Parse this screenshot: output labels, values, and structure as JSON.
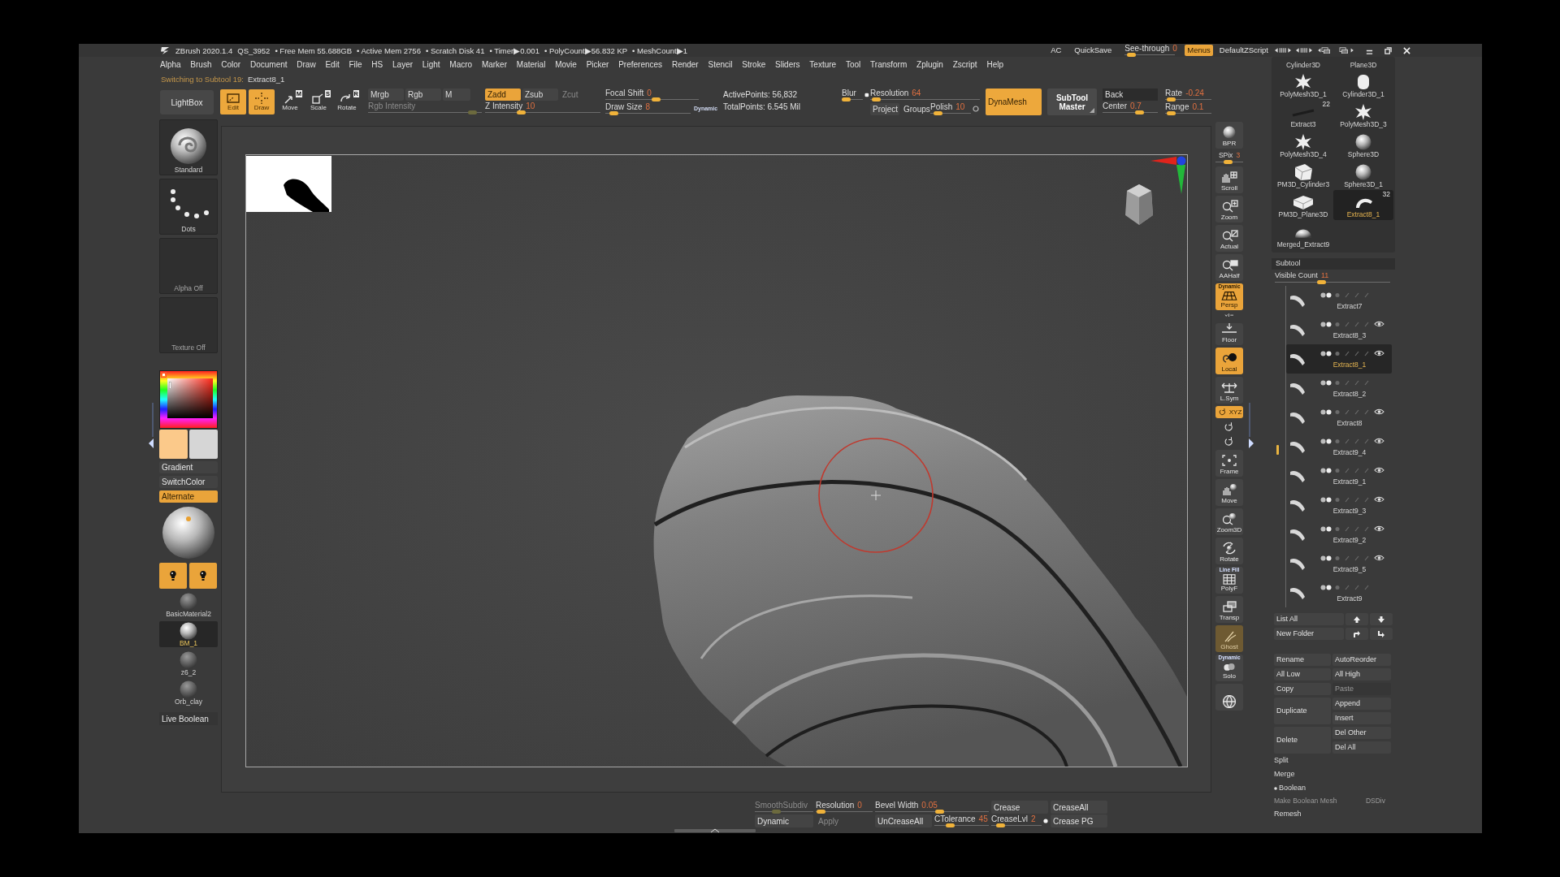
{
  "title_bar": {
    "app": "ZBrush 2020.1.4",
    "project": "QS_3952",
    "stats": [
      "• Free Mem 55.688GB",
      "• Active Mem 2756",
      "• Scratch Disk 41",
      "• Timer▶0.001",
      "• PolyCount▶56.832 KP",
      "• MeshCount▶1"
    ],
    "ac": "AC",
    "quicksave": "QuickSave",
    "see_through": {
      "label": "See-through",
      "value": "0",
      "level": 0.05
    },
    "menus": {
      "label": "Menus",
      "on": true
    },
    "script": "DefaultZScript"
  },
  "menu": [
    "Alpha",
    "Brush",
    "Color",
    "Document",
    "Draw",
    "Edit",
    "File",
    "HS",
    "Layer",
    "Light",
    "Macro",
    "Marker",
    "Material",
    "Movie",
    "Picker",
    "Preferences",
    "Render",
    "Stencil",
    "Stroke",
    "Sliders",
    "Texture",
    "Tool",
    "Transform",
    "Zplugin",
    "Zscript",
    "Help"
  ],
  "notice": {
    "label": "Switching to Subtool 19:",
    "value": "Extract8_1"
  },
  "top_shelf": {
    "lightbox": "LightBox",
    "tools": [
      {
        "kind": "edit",
        "label": "Edit",
        "on": true
      },
      {
        "kind": "draw",
        "label": "Draw",
        "on": true
      },
      {
        "kind": "move",
        "label": "Move",
        "hotkey": "M",
        "on": false
      },
      {
        "kind": "scale",
        "label": "Scale",
        "hotkey": "S",
        "on": false
      },
      {
        "kind": "rotate",
        "label": "Rotate",
        "hotkey": "R",
        "on": false
      }
    ],
    "color_modes": [
      {
        "label": "Mrgb",
        "on": false
      },
      {
        "label": "Rgb",
        "on": false
      },
      {
        "label": "M",
        "on": false
      }
    ],
    "rgb_intensity": {
      "label": "Rgb Intensity",
      "level": 0.95,
      "disabled": true
    },
    "z_modes": [
      {
        "label": "Zadd",
        "on": true,
        "disabled": false
      },
      {
        "label": "Zsub",
        "on": false,
        "disabled": false
      },
      {
        "label": "Zcut",
        "on": false,
        "disabled": true
      }
    ],
    "z_intensity": {
      "label": "Z Intensity",
      "value": "10",
      "level": 0.3
    },
    "focal_shift": {
      "label": "Focal Shift",
      "value": "0",
      "level": 0.55
    },
    "draw_size": {
      "label": "Draw Size",
      "value": "8",
      "level": 0.05
    },
    "dynamic": "Dynamic",
    "points": [
      "ActivePoints: 56,832",
      "TotalPoints: 6.545 Mil"
    ],
    "blur": {
      "label": "Blur",
      "level": 0.03,
      "on": true
    },
    "resolution": {
      "label": "Resolution",
      "value": "64",
      "level": 0.02
    },
    "project": "Project",
    "groups": "Groups",
    "polish": {
      "label": "Polish",
      "value": "10",
      "level": 0.1,
      "on": false
    },
    "dynamesh": {
      "label": "DynaMesh",
      "on": true
    },
    "subtool_master": "SubTool Master",
    "back": "Back",
    "center": {
      "label": "Center",
      "value": "0.7",
      "level": 0.7
    },
    "rate": {
      "label": "Rate",
      "value": "-0.24",
      "level": 0.05
    },
    "range": {
      "label": "Range",
      "value": "0.1",
      "level": 0.05
    }
  },
  "left_shelf": {
    "tiles": [
      {
        "kind": "brush",
        "label": "Standard"
      },
      {
        "kind": "stroke",
        "label": "Dots"
      },
      {
        "kind": "alpha",
        "label": "Alpha Off"
      },
      {
        "kind": "texture",
        "label": "Texture Off"
      }
    ],
    "swatches": [
      {
        "color": "#fbc98a"
      },
      {
        "color": "#d6d6d6"
      }
    ],
    "color_buttons": [
      {
        "label": "Gradient",
        "on": false
      },
      {
        "label": "SwitchColor",
        "on": false
      },
      {
        "label": "Alternate",
        "on": true
      }
    ],
    "lights": [
      {
        "on": true
      },
      {
        "on": true
      }
    ],
    "materials": [
      {
        "label": "BasicMaterial2",
        "selected": false
      },
      {
        "label": "BM_1",
        "selected": true
      },
      {
        "label": "z6_2",
        "selected": false
      },
      {
        "label": "Orb_clay",
        "selected": false
      }
    ],
    "live_boolean": "Live Boolean"
  },
  "nav": [
    {
      "kind": "bpr",
      "label": "BPR",
      "on": false,
      "disabled": false
    },
    {
      "kind": "slider",
      "label": "SPix",
      "value": "3",
      "level": 0.45
    },
    {
      "kind": "scroll",
      "label": "Scroll",
      "on": false,
      "disabled": false
    },
    {
      "kind": "zoom",
      "label": "Zoom",
      "on": false,
      "disabled": false
    },
    {
      "kind": "actual",
      "label": "Actual",
      "on": false,
      "disabled": false
    },
    {
      "kind": "aahalf",
      "label": "AAHalf",
      "on": false,
      "disabled": false
    },
    {
      "kind": "persp",
      "label": "Persp",
      "caption": "Dynamic",
      "on": true,
      "disabled": false
    },
    {
      "kind": "axis",
      "on": false,
      "disabled": false
    },
    {
      "kind": "floor",
      "label": "Floor",
      "on": false,
      "disabled": false
    },
    {
      "kind": "local",
      "label": "Local",
      "on": true,
      "disabled": false
    },
    {
      "kind": "lsym",
      "label": "L.Sym",
      "on": false,
      "disabled": false
    },
    {
      "kind": "xyz",
      "label": "XYZ",
      "on": true,
      "disabled": false
    },
    {
      "kind": "rot",
      "on": false,
      "disabled": false
    },
    {
      "kind": "rot",
      "on": false,
      "disabled": false
    },
    {
      "kind": "frame",
      "label": "Frame",
      "on": false,
      "disabled": false
    },
    {
      "kind": "move",
      "label": "Move",
      "on": false,
      "disabled": false
    },
    {
      "kind": "zoom3d",
      "label": "Zoom3D",
      "on": false,
      "disabled": false
    },
    {
      "kind": "rotate",
      "label": "Rotate",
      "on": false,
      "disabled": false
    },
    {
      "kind": "polyf",
      "label": "PolyF",
      "caption": "Line Fill",
      "on": false,
      "disabled": false
    },
    {
      "kind": "transp",
      "label": "Transp",
      "on": false,
      "disabled": false
    },
    {
      "kind": "ghost",
      "label": "Ghost",
      "on": true,
      "disabled": true
    },
    {
      "kind": "solo",
      "label": "Solo",
      "caption": "Dynamic",
      "on": false,
      "disabled": false
    },
    {
      "kind": "sphere",
      "on": false,
      "disabled": false
    }
  ],
  "bottom_shelf": {
    "columns": [
      {
        "top": {
          "kind": "slider",
          "label": "SmoothSubdiv",
          "level": 0.35,
          "disabled": true
        },
        "bottom": [
          {
            "kind": "button",
            "label": "Dynamic",
            "disabled": false
          }
        ]
      },
      {
        "top": {
          "kind": "slider",
          "label": "Resolution",
          "value": "0",
          "level": 0.02,
          "disabled": false
        },
        "bottom": [
          {
            "kind": "button",
            "label": "Apply",
            "disabled": true
          }
        ]
      },
      {
        "top": {
          "kind": "slider",
          "label": "Bevel Width",
          "value": "0.05",
          "level": 0.57,
          "disabled": false
        },
        "bottom": [
          {
            "kind": "button",
            "label": "UnCreaseAll",
            "disabled": false
          },
          {
            "kind": "slider",
            "label": "CTolerance",
            "value": "45",
            "level": 0.25,
            "disabled": false
          }
        ]
      },
      {
        "top": {
          "kind": "button",
          "label": "Crease",
          "disabled": false
        },
        "bottom": [
          {
            "kind": "slider-toggle",
            "label": "CreaseLvl",
            "value": "2",
            "level": 0.12,
            "disabled": false,
            "on": true
          }
        ]
      },
      {
        "top": {
          "kind": "button",
          "label": "CreaseAll",
          "disabled": false
        },
        "bottom": [
          {
            "kind": "button",
            "label": "Crease PG",
            "disabled": false
          }
        ]
      }
    ]
  },
  "tool_palette": {
    "tools": [
      {
        "kind": "none",
        "label": "Cylinder3D",
        "selected": false
      },
      {
        "kind": "none",
        "label": "Plane3D",
        "selected": false
      },
      {
        "kind": "star",
        "label": "PolyMesh3D_1",
        "selected": false
      },
      {
        "kind": "cylinder",
        "label": "Cylinder3D_1",
        "selected": false
      },
      {
        "kind": "strip",
        "label": "Extract3",
        "badge": "22",
        "selected": false
      },
      {
        "kind": "star",
        "label": "PolyMesh3D_3",
        "selected": false
      },
      {
        "kind": "star",
        "label": "PolyMesh3D_4",
        "selected": false
      },
      {
        "kind": "sphere",
        "label": "Sphere3D",
        "selected": false
      },
      {
        "kind": "box",
        "label": "PM3D_Cylinder3",
        "selected": false
      },
      {
        "kind": "sphere",
        "label": "Sphere3D_1",
        "selected": false
      },
      {
        "kind": "slab",
        "label": "PM3D_Plane3D",
        "selected": false
      },
      {
        "kind": "extract",
        "label": "Extract8_1",
        "badge": "32",
        "selected": true
      },
      {
        "kind": "dome",
        "label": "Merged_Extract9",
        "selected": false
      }
    ]
  },
  "subtool": {
    "title": "Subtool",
    "visible_count": {
      "label": "Visible Count",
      "value": "11",
      "level": 0.4
    },
    "rows": [
      {
        "name": "Extract7",
        "visible": false,
        "selected": false
      },
      {
        "name": "Extract8_3",
        "visible": true,
        "selected": false
      },
      {
        "name": "Extract8_1",
        "visible": true,
        "selected": true
      },
      {
        "name": "Extract8_2",
        "visible": false,
        "selected": false
      },
      {
        "name": "Extract8",
        "visible": true,
        "selected": false
      },
      {
        "name": "Extract9_4",
        "visible": true,
        "selected": false
      },
      {
        "name": "Extract9_1",
        "visible": true,
        "selected": false
      },
      {
        "name": "Extract9_3",
        "visible": true,
        "selected": false
      },
      {
        "name": "Extract9_2",
        "visible": true,
        "selected": false
      },
      {
        "name": "Extract9_5",
        "visible": true,
        "selected": false
      },
      {
        "name": "Extract9",
        "visible": false,
        "selected": false
      }
    ],
    "list_all": "List All",
    "new_folder": "New Folder",
    "actions": [
      {
        "left": "Rename",
        "right": [
          {
            "label": "AutoReorder",
            "disabled": false
          }
        ]
      },
      {
        "left": "All Low",
        "right": [
          {
            "label": "All High",
            "disabled": false
          }
        ]
      },
      {
        "left": "Copy",
        "right": [
          {
            "label": "Paste",
            "disabled": true
          }
        ]
      },
      {
        "left": "Duplicate",
        "right": [
          {
            "label": "Append",
            "disabled": false
          },
          {
            "label": "Insert",
            "disabled": false
          }
        ]
      },
      {
        "left": "Delete",
        "right": [
          {
            "label": "Del Other",
            "disabled": false
          },
          {
            "label": "Del All",
            "disabled": false
          }
        ]
      }
    ],
    "sections": [
      {
        "label": "Split",
        "expanded": false
      },
      {
        "label": "Merge",
        "expanded": false
      },
      {
        "label": "Boolean",
        "expanded": true,
        "items": [
          {
            "label": "Make Boolean Mesh",
            "disabled": true
          },
          {
            "label": "DSDiv",
            "disabled": true
          }
        ]
      },
      {
        "label": "Remesh",
        "expanded": false
      }
    ]
  }
}
